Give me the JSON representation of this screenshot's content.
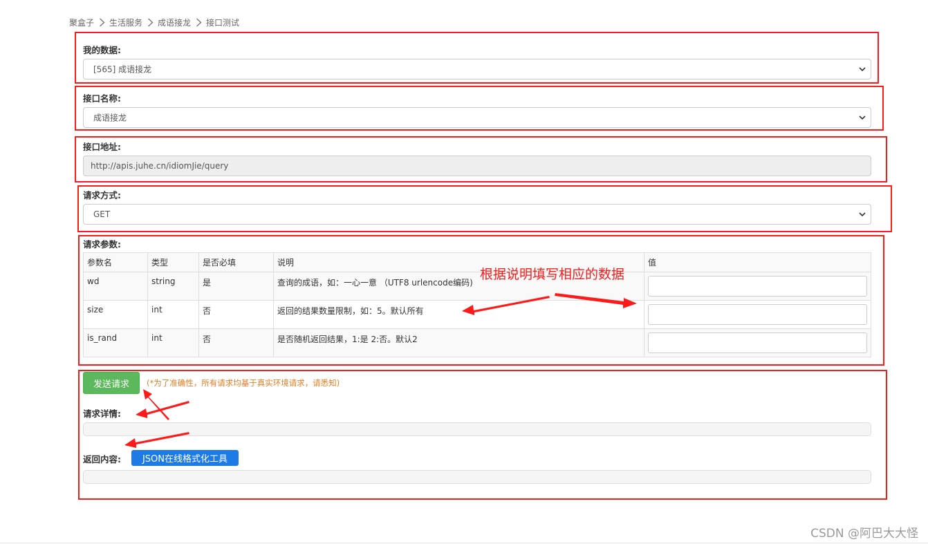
{
  "breadcrumb": [
    "聚盒子",
    "生活服务",
    "成语接龙",
    "接口测试"
  ],
  "form": {
    "my_data": {
      "label": "我的数据:",
      "value": "[565] 成语接龙"
    },
    "api_name": {
      "label": "接口名称:",
      "value": "成语接龙"
    },
    "api_url": {
      "label": "接口地址:",
      "value": "http://apis.juhe.cn/idiomJie/query"
    },
    "method": {
      "label": "请求方式:",
      "value": "GET"
    }
  },
  "params": {
    "label": "请求参数:",
    "headers": [
      "参数名",
      "类型",
      "是否必填",
      "说明",
      "值"
    ],
    "rows": [
      {
        "name": "wd",
        "type": "string",
        "required": "是",
        "desc": "查询的成语，如：一心一意 （UTF8 urlencode编码)",
        "value": ""
      },
      {
        "name": "size",
        "type": "int",
        "required": "否",
        "desc": "返回的结果数量限制，如：5。默认所有",
        "value": ""
      },
      {
        "name": "is_rand",
        "type": "int",
        "required": "否",
        "desc": "是否随机返回结果，1:是 2:否。默认2",
        "value": ""
      }
    ]
  },
  "actions": {
    "send_label": "发送请求",
    "note": "(*为了准确性，所有请求均基于真实环境请求，请悉知)"
  },
  "request_detail": {
    "label": "请求详情:"
  },
  "response": {
    "label": "返回内容:",
    "json_tool_label": "JSON在线格式化工具"
  },
  "annotation": "根据说明填写相应的数据",
  "watermark": "CSDN @阿巴大大怪",
  "colors": {
    "annotation_red": "#ff1a1a",
    "send_green": "#5cb85c",
    "json_blue": "#1e7be6",
    "note_orange": "#e67e22"
  },
  "icons": [
    "chevron-right-icon",
    "chevron-down-icon",
    "arrow-annotation-icon"
  ]
}
